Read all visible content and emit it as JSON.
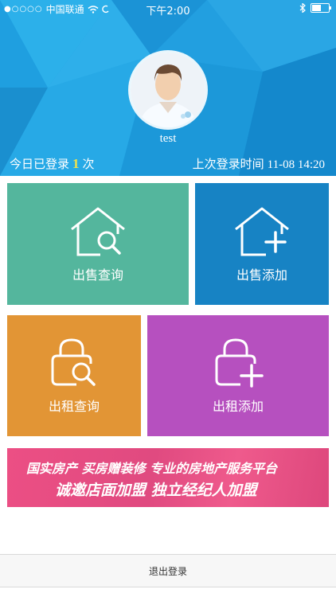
{
  "status_bar": {
    "carrier": "中国联通",
    "time": "下午2:00",
    "battery_level": 0.5
  },
  "profile": {
    "username": "test",
    "login_count_prefix": "今日已登录",
    "login_count": "1",
    "login_count_suffix": "次",
    "last_login_label": "上次登录时间",
    "last_login_time": "11-08 14:20"
  },
  "tiles": [
    {
      "label": "出售查询",
      "icon": "house-search-icon",
      "color": "#54b69d"
    },
    {
      "label": "出售添加",
      "icon": "house-add-icon",
      "color": "#1783c4"
    },
    {
      "label": "出租查询",
      "icon": "lock-search-icon",
      "color": "#e29535"
    },
    {
      "label": "出租添加",
      "icon": "lock-add-icon",
      "color": "#b650bf"
    }
  ],
  "banner": {
    "line1": "国实房产  买房赠装修  专业的房地产服务平台",
    "line2": "诚邀店面加盟  独立经纪人加盟"
  },
  "logout": {
    "label": "退出登录"
  },
  "colors": {
    "header": "#1f9fe0",
    "highlight_count": "#f2e24a"
  }
}
